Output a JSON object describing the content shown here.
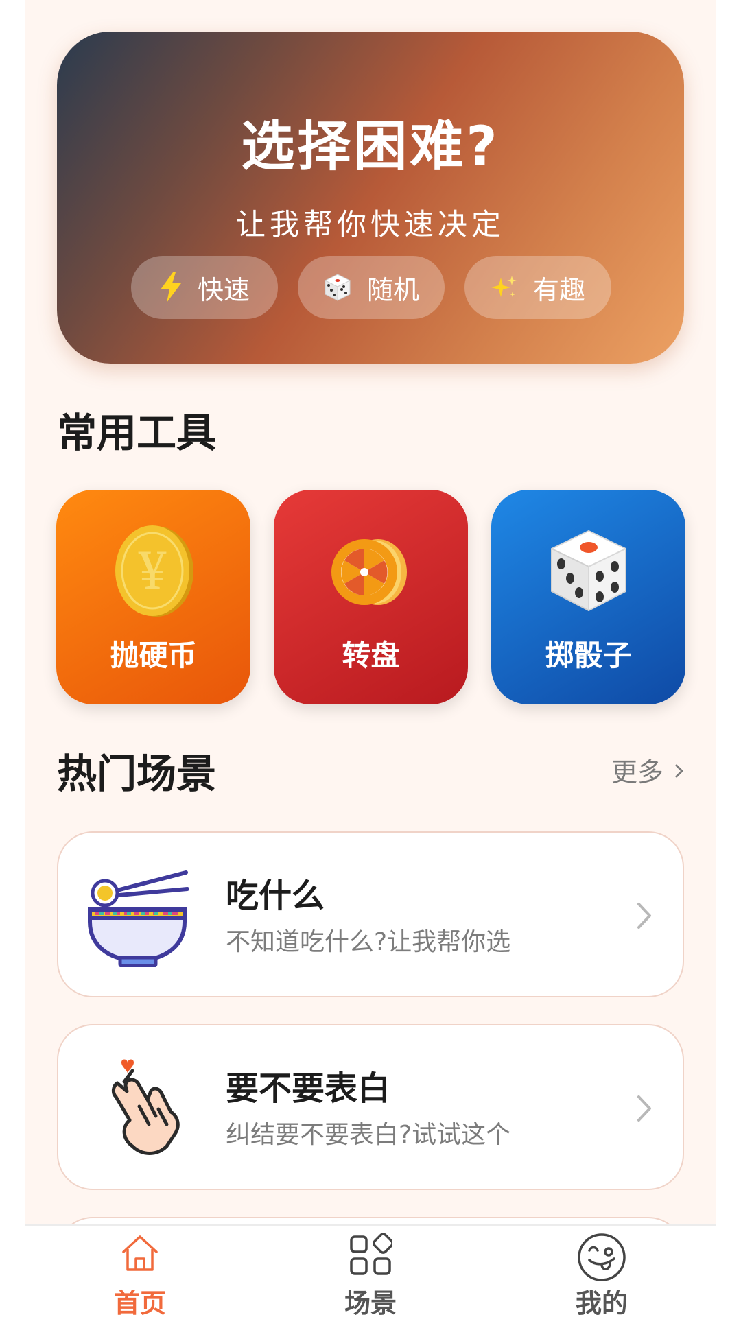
{
  "hero": {
    "title": "选择困难?",
    "subtitle": "让我帮你快速决定",
    "tags": [
      {
        "icon": "lightning-icon",
        "label": "快速"
      },
      {
        "icon": "dice-icon",
        "label": "随机"
      },
      {
        "icon": "sparkles-icon",
        "label": "有趣"
      }
    ]
  },
  "tools": {
    "section_title": "常用工具",
    "items": [
      {
        "icon": "coin-icon",
        "label": "抛硬币",
        "color": "#f7700f"
      },
      {
        "icon": "wheel-icon",
        "label": "转盘",
        "color": "#d42a2c"
      },
      {
        "icon": "dice-icon",
        "label": "掷骰子",
        "color": "#1869c8"
      }
    ]
  },
  "scenes": {
    "section_title": "热门场景",
    "more_label": "更多",
    "items": [
      {
        "icon": "noodle-bowl-icon",
        "title": "吃什么",
        "description": "不知道吃什么?让我帮你选"
      },
      {
        "icon": "finger-heart-icon",
        "title": "要不要表白",
        "description": "纠结要不要表白?试试这个"
      }
    ]
  },
  "tabbar": {
    "active": "home",
    "accent_color": "#f16a3c",
    "items": [
      {
        "icon": "home-icon",
        "label": "首页"
      },
      {
        "icon": "grid-icon",
        "label": "场景"
      },
      {
        "icon": "smiley-icon",
        "label": "我的"
      }
    ]
  }
}
